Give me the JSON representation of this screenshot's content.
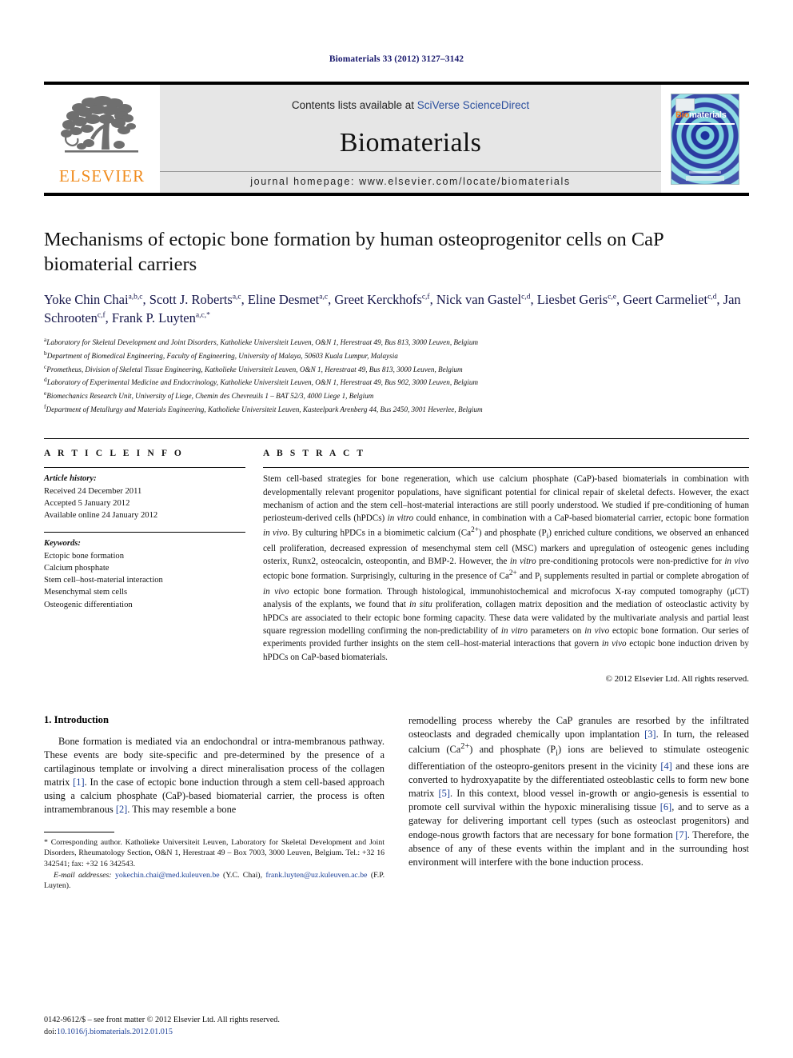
{
  "running_head": "Biomaterials 33 (2012) 3127–3142",
  "masthead": {
    "contents_prefix": "Contents lists available at ",
    "sciencedirect": "SciVerse ScienceDirect",
    "journal_name": "Biomaterials",
    "homepage": "journal homepage: www.elsevier.com/locate/biomaterials",
    "publisher_logo_text": "ELSEVIER",
    "cover_title_a": "Bio",
    "cover_title_b": "materials",
    "accent_link_color": "#2b4f9e",
    "elsevier_orange": "#f08c1e"
  },
  "article": {
    "title": "Mechanisms of ectopic bone formation by human osteoprogenitor cells on CaP biomaterial carriers",
    "authors_html": "Yoke Chin Chai<sup>a,b,c</sup>, Scott J. Roberts<sup>a,c</sup>, Eline Desmet<sup>a,c</sup>, Greet Kerckhofs<sup>c,f</sup>, Nick van Gastel<sup>c,d</sup>, Liesbet Geris<sup>c,e</sup>, Geert Carmeliet<sup>c,d</sup>, Jan Schrooten<sup>c,f</sup>, Frank P. Luyten<sup>a,c,*</sup>",
    "affiliations": [
      {
        "mark": "a",
        "text": "Laboratory for Skeletal Development and Joint Disorders, Katholieke Universiteit Leuven, O&N 1, Herestraat 49, Bus 813, 3000 Leuven, Belgium"
      },
      {
        "mark": "b",
        "text": "Department of Biomedical Engineering, Faculty of Engineering, University of Malaya, 50603 Kuala Lumpur, Malaysia"
      },
      {
        "mark": "c",
        "text": "Prometheus, Division of Skeletal Tissue Engineering, Katholieke Universiteit Leuven, O&N 1, Herestraat 49, Bus 813, 3000 Leuven, Belgium"
      },
      {
        "mark": "d",
        "text": "Laboratory of Experimental Medicine and Endocrinology, Katholieke Universiteit Leuven, O&N 1, Herestraat 49, Bus 902, 3000 Leuven, Belgium"
      },
      {
        "mark": "e",
        "text": "Biomechanics Research Unit, University of Liege, Chemin des Chevreuils 1 – BAT 52/3, 4000 Liege 1, Belgium"
      },
      {
        "mark": "f",
        "text": "Department of Metallurgy and Materials Engineering, Katholieke Universiteit Leuven, Kasteelpark Arenberg 44, Bus 2450, 3001 Heverlee, Belgium"
      }
    ]
  },
  "article_info": {
    "heading": "A R T I C L E  I N F O",
    "history_label": "Article history:",
    "history": [
      "Received 24 December 2011",
      "Accepted 5 January 2012",
      "Available online 24 January 2012"
    ],
    "keywords_label": "Keywords:",
    "keywords": [
      "Ectopic bone formation",
      "Calcium phosphate",
      "Stem cell–host-material interaction",
      "Mesenchymal stem cells",
      "Osteogenic differentiation"
    ]
  },
  "abstract": {
    "heading": "A B S T R A C T",
    "text_html": "Stem cell-based strategies for bone regeneration, which use calcium phosphate (CaP)-based biomaterials in combination with developmentally relevant progenitor populations, have significant potential for clinical repair of skeletal defects. However, the exact mechanism of action and the stem cell–host-material interactions are still poorly understood. We studied if pre-conditioning of human periosteum-derived cells (hPDCs) <em>in vitro</em> could enhance, in combination with a CaP-based biomaterial carrier, ectopic bone formation <em>in vivo</em>. By culturing hPDCs in a biomimetic calcium (Ca<sup>2+</sup>) and phosphate (P<sub>i</sub>) enriched culture conditions, we observed an enhanced cell proliferation, decreased expression of mesenchymal stem cell (MSC) markers and upregulation of osteogenic genes including osterix, Runx2, osteocalcin, osteopontin, and BMP-2. However, the <em>in vitro</em> pre-conditioning protocols were non-predictive for <em>in vivo</em> ectopic bone formation. Surprisingly, culturing in the presence of Ca<sup>2+</sup> and P<sub>i</sub> supplements resulted in partial or complete abrogation of <em>in vivo</em> ectopic bone formation. Through histological, immunohistochemical and microfocus X-ray computed tomography (μCT) analysis of the explants, we found that <em>in situ</em> proliferation, collagen matrix deposition and the mediation of osteoclastic activity by hPDCs are associated to their ectopic bone forming capacity. These data were validated by the multivariate analysis and partial least square regression modelling confirming the non-predictability of <em>in vitro</em> parameters on <em>in vivo</em> ectopic bone formation. Our series of experiments provided further insights on the stem cell–host-material interactions that govern <em>in vivo</em> ectopic bone induction driven by hPDCs on CaP-based biomaterials.",
    "copyright": "© 2012 Elsevier Ltd. All rights reserved."
  },
  "introduction": {
    "heading": "1. Introduction",
    "left_paragraph_html": "Bone formation is mediated via an endochondral or intra-membranous pathway. These events are body site-specific and pre-determined by the presence of a cartilaginous template or involving a direct mineralisation process of the collagen matrix <span class=\"ref\">[1]</span>. In the case of ectopic bone induction through a stem cell-based approach using a calcium phosphate (CaP)-based biomaterial carrier, the process is often intramembranous <span class=\"ref\">[2]</span>. This may resemble a bone",
    "right_paragraph_html": "remodelling process whereby the CaP granules are resorbed by the infiltrated osteoclasts and degraded chemically upon implantation <span class=\"ref\">[3]</span>. In turn, the released calcium (Ca<sup>2+</sup>) and phosphate (P<sub>i</sub>) ions are believed to stimulate osteogenic differentiation of the osteopro-genitors present in the vicinity <span class=\"ref\">[4]</span> and these ions are converted to hydroxyapatite by the differentiated osteoblastic cells to form new bone matrix <span class=\"ref\">[5]</span>. In this context, blood vessel in-growth or angio-genesis is essential to promote cell survival within the hypoxic mineralising tissue <span class=\"ref\">[6]</span>, and to serve as a gateway for delivering important cell types (such as osteoclast progenitors) and endoge-nous growth factors that are necessary for bone formation <span class=\"ref\">[7]</span>. Therefore, the absence of any of these events within the implant and in the surrounding host environment will interfere with the bone induction process."
  },
  "footnote": {
    "corresponding_html": "* Corresponding author. Katholieke Universiteit Leuven, Laboratory for Skeletal Development and Joint Disorders, Rheumatology Section, O&N 1, Herestraat 49 – Box 7003, 3000 Leuven, Belgium. Tel.: +32 16 342541; fax: +32 16 342543.",
    "email_html": "<em>E-mail addresses:</em> <span class=\"link\">yokechin.chai@med.kuleuven.be</span> (Y.C. Chai), <span class=\"link\">frank.luyten@uz.kuleuven.ac.be</span> (F.P. Luyten)."
  },
  "issn": {
    "line1_html": "0142-9612/$ – see front matter © 2012 Elsevier Ltd. All rights reserved.",
    "line2_html": "doi:<span class=\"link\">10.1016/j.biomaterials.2012.01.015</span>"
  }
}
